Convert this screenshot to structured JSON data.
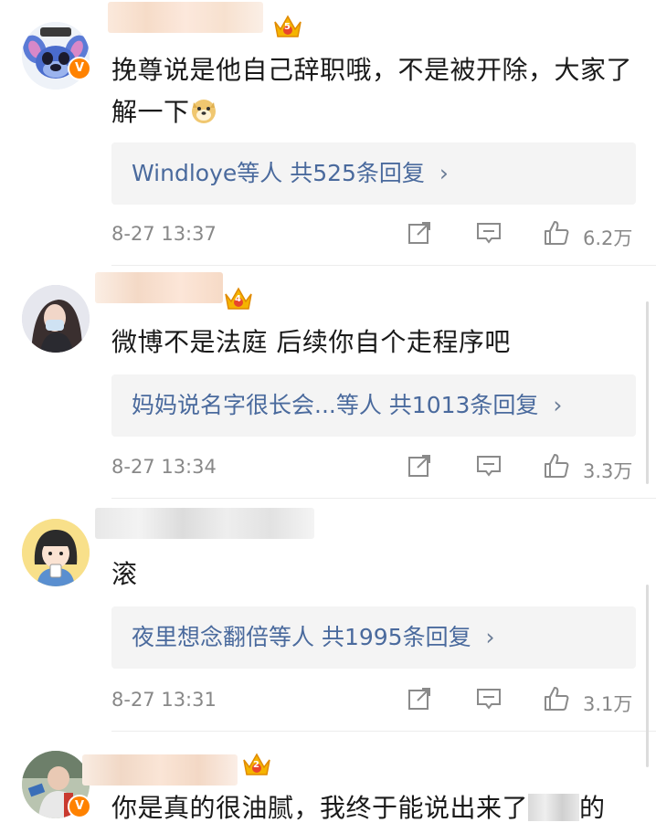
{
  "comments": [
    {
      "text": "挽尊说是他自己辞职哦，不是被开除，大家了解一下",
      "crown_level": "5",
      "reply": {
        "names": "Windloye等人",
        "count": "共525条回复",
        "chevron": "›"
      },
      "time": "8-27 13:37",
      "likes": "6.2万"
    },
    {
      "text": "微博不是法庭 后续你自个走程序吧",
      "crown_level": "4",
      "reply": {
        "names": "妈妈说名字很长会...等人",
        "count": "共1013条回复",
        "chevron": "›"
      },
      "time": "8-27 13:34",
      "likes": "3.3万"
    },
    {
      "text": "滚",
      "crown_level": "",
      "reply": {
        "names": "夜里想念翻倍等人",
        "count": "共1995条回复",
        "chevron": "›"
      },
      "time": "8-27 13:31",
      "likes": "3.1万"
    },
    {
      "text_before": "你是真的很油腻，我终于能说出来了",
      "text_after": "的",
      "crown_level": "2"
    }
  ],
  "badge_v": "V",
  "colors": {
    "link_blue": "#4a6a9d",
    "verified_orange": "#ff8200",
    "crown_gold": "#f5b400",
    "crown_red": "#e8452c"
  },
  "icons": [
    "share-icon",
    "comment-icon",
    "like-icon",
    "crown-icon",
    "verified-badge-icon",
    "doge-emoji-icon"
  ]
}
